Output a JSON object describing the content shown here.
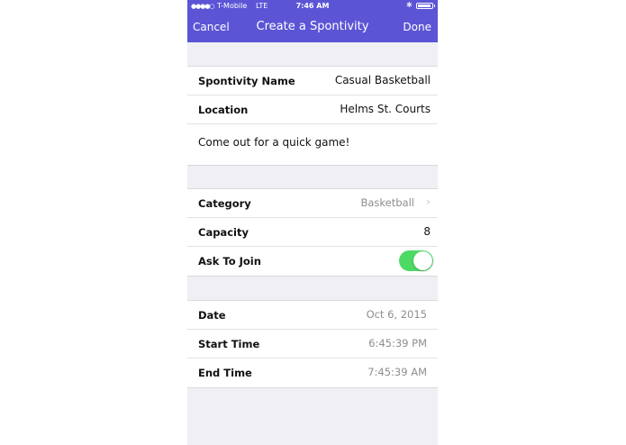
{
  "colors": {
    "nav_bar": "#5b55d6",
    "toggle_on": "#4cd964",
    "group_background": "#efeff4"
  },
  "status_bar": {
    "signal": "●●●●○",
    "carrier": "T-Mobile",
    "network": "LTE",
    "time": "7:46 AM",
    "bluetooth_icon": "bluetooth-icon",
    "battery_icon": "battery-icon",
    "battery_level_percent": 90
  },
  "nav": {
    "cancel_label": "Cancel",
    "title": "Create a Spontivity",
    "done_label": "Done"
  },
  "details": {
    "name_label": "Spontivity Name",
    "name_value": "Casual Basketball",
    "location_label": "Location",
    "location_value": "Helms St. Courts",
    "description": "Come out for a quick game!"
  },
  "settings": {
    "category_label": "Category",
    "category_value": "Basketball",
    "category_icon": "chevron-right-icon",
    "capacity_label": "Capacity",
    "capacity_value": "8",
    "ask_to_join_label": "Ask To Join",
    "ask_to_join_on": true
  },
  "schedule": {
    "date_label": "Date",
    "date_value": "Oct 6, 2015",
    "start_label": "Start Time",
    "start_value": "6:45:39 PM",
    "end_label": "End Time",
    "end_value": "7:45:39 AM"
  }
}
